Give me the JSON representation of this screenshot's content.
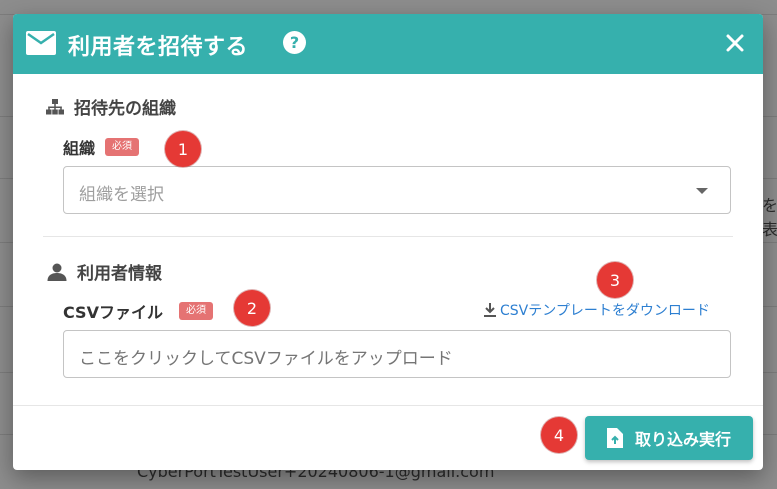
{
  "background": {
    "email_text": "CyberPortTestUser+20240806-1@gmail.com",
    "side_text": "を表"
  },
  "dialog": {
    "title": "利用者を招待する",
    "help_icon": "?",
    "header_icon": "mail-icon"
  },
  "organization_section": {
    "title": "招待先の組織",
    "icon": "sitemap-icon",
    "field_label": "組織",
    "required_badge": "必須",
    "select_placeholder": "組織を選択"
  },
  "user_section": {
    "title": "利用者情報",
    "icon": "person-icon",
    "field_label": "CSVファイル",
    "required_badge": "必須",
    "template_link": "CSVテンプレートをダウンロード",
    "upload_placeholder": "ここをクリックしてCSVファイルをアップロード"
  },
  "footer": {
    "import_button": "取り込み実行"
  },
  "markers": [
    "1",
    "2",
    "3",
    "4"
  ],
  "colors": {
    "primary": "#36b0ad",
    "required_badge": "#e57373",
    "link": "#2d7fd1",
    "marker": "#e53935"
  }
}
